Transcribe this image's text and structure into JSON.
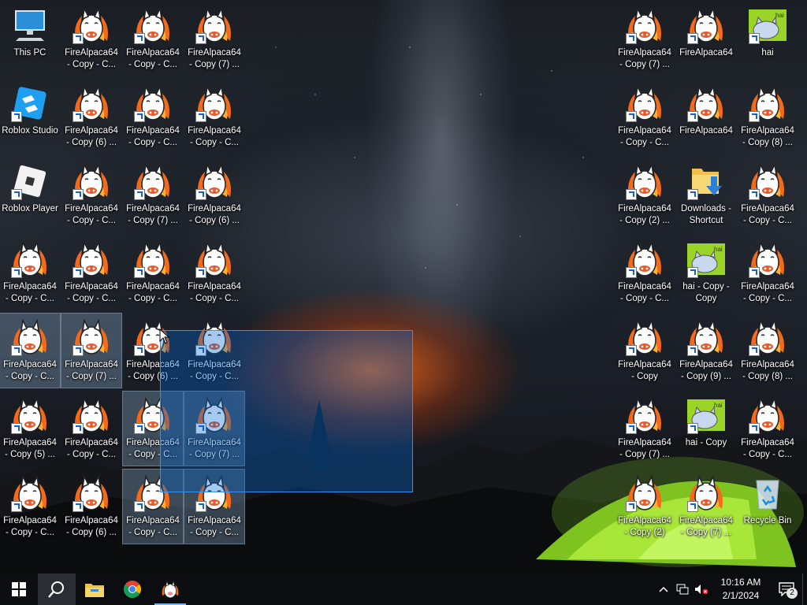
{
  "desktop": {
    "icons": [
      {
        "label": "This PC",
        "type": "thispc",
        "selected": false
      },
      {
        "label": "FireAlpaca64\n- Copy - C...",
        "type": "alpaca",
        "selected": false
      },
      {
        "label": "FireAlpaca64\n- Copy - C...",
        "type": "alpaca",
        "selected": false
      },
      {
        "label": "FireAlpaca64\n- Copy (7) ...",
        "type": "alpaca",
        "selected": false
      },
      {
        "label": "Roblox Studio",
        "type": "roblox-studio",
        "selected": false
      },
      {
        "label": "FireAlpaca64\n- Copy (6) ...",
        "type": "alpaca",
        "selected": false
      },
      {
        "label": "FireAlpaca64\n- Copy - C...",
        "type": "alpaca",
        "selected": false
      },
      {
        "label": "FireAlpaca64\n- Copy - C...",
        "type": "alpaca",
        "selected": false
      },
      {
        "label": "Roblox Player",
        "type": "roblox-player",
        "selected": false
      },
      {
        "label": "FireAlpaca64\n- Copy - C...",
        "type": "alpaca",
        "selected": false
      },
      {
        "label": "FireAlpaca64\n- Copy (7) ...",
        "type": "alpaca",
        "selected": false
      },
      {
        "label": "FireAlpaca64\n- Copy (6) ...",
        "type": "alpaca",
        "selected": false
      },
      {
        "label": "FireAlpaca64\n- Copy - C...",
        "type": "alpaca",
        "selected": false
      },
      {
        "label": "FireAlpaca64\n- Copy - C...",
        "type": "alpaca",
        "selected": false
      },
      {
        "label": "FireAlpaca64\n- Copy - C...",
        "type": "alpaca",
        "selected": false
      },
      {
        "label": "FireAlpaca64\n- Copy - C...",
        "type": "alpaca",
        "selected": false
      },
      {
        "label": "FireAlpaca64\n- Copy - C...",
        "type": "alpaca",
        "selected": true
      },
      {
        "label": "FireAlpaca64\n- Copy (7) ...",
        "type": "alpaca",
        "selected": true
      },
      {
        "label": "FireAlpaca64\n- Copy (6) ...",
        "type": "alpaca",
        "selected": false
      },
      {
        "label": "FireAlpaca64\n- Copy - C...",
        "type": "alpaca",
        "selected": false
      },
      {
        "label": "FireAlpaca64\n- Copy (5) ...",
        "type": "alpaca",
        "selected": false
      },
      {
        "label": "FireAlpaca64\n- Copy - C...",
        "type": "alpaca",
        "selected": false
      },
      {
        "label": "FireAlpaca64\n- Copy - C...",
        "type": "alpaca",
        "selected": true
      },
      {
        "label": "FireAlpaca64\n- Copy (7) ...",
        "type": "alpaca",
        "selected": true
      },
      {
        "label": "FireAlpaca64\n- Copy - C...",
        "type": "alpaca",
        "selected": false
      },
      {
        "label": "FireAlpaca64\n- Copy (6) ...",
        "type": "alpaca",
        "selected": false
      },
      {
        "label": "FireAlpaca64\n- Copy - C...",
        "type": "alpaca",
        "selected": true
      },
      {
        "label": "FireAlpaca64\n- Copy - C...",
        "type": "alpaca",
        "selected": true
      },
      {
        "label": "FireAlpaca64\n- Copy (7) ...",
        "type": "alpaca",
        "selected": false
      },
      {
        "label": "FireAlpaca64",
        "type": "alpaca",
        "selected": false
      },
      {
        "label": "hai",
        "type": "hai",
        "selected": false
      },
      {
        "label": "FireAlpaca64\n- Copy - C...",
        "type": "alpaca",
        "selected": false
      },
      {
        "label": "FireAlpaca64",
        "type": "alpaca",
        "selected": false
      },
      {
        "label": "FireAlpaca64\n- Copy (8) ...",
        "type": "alpaca",
        "selected": false
      },
      {
        "label": "FireAlpaca64\n- Copy (2) ...",
        "type": "alpaca",
        "selected": false
      },
      {
        "label": "Downloads -\nShortcut",
        "type": "downloads",
        "selected": false
      },
      {
        "label": "FireAlpaca64\n- Copy - C...",
        "type": "alpaca",
        "selected": false
      },
      {
        "label": "FireAlpaca64\n- Copy - C...",
        "type": "alpaca",
        "selected": false
      },
      {
        "label": "hai - Copy -\nCopy",
        "type": "hai",
        "selected": false
      },
      {
        "label": "FireAlpaca64\n- Copy - C...",
        "type": "alpaca",
        "selected": false
      },
      {
        "label": "FireAlpaca64\n- Copy",
        "type": "alpaca",
        "selected": false
      },
      {
        "label": "FireAlpaca64\n- Copy (9) ...",
        "type": "alpaca",
        "selected": false
      },
      {
        "label": "FireAlpaca64\n- Copy (8) ...",
        "type": "alpaca",
        "selected": false
      },
      {
        "label": "FireAlpaca64\n- Copy (7) ...",
        "type": "alpaca",
        "selected": false
      },
      {
        "label": "hai - Copy",
        "type": "hai",
        "selected": false
      },
      {
        "label": "FireAlpaca64\n- Copy - C...",
        "type": "alpaca",
        "selected": false
      },
      {
        "label": "FireAlpaca64\n- Copy (2)",
        "type": "alpaca",
        "selected": false
      },
      {
        "label": "FireAlpaca64\n- Copy (7) ...",
        "type": "alpaca",
        "selected": false
      },
      {
        "label": "Recycle Bin",
        "type": "recycle",
        "selected": false
      }
    ]
  },
  "taskbar": {
    "start_icon": "windows-logo-icon",
    "search_icon": "search-icon",
    "pinned": [
      {
        "name": "file-explorer-icon"
      },
      {
        "name": "chrome-icon"
      },
      {
        "name": "firealpaca-icon"
      }
    ],
    "clock_time": "10:16 AM",
    "clock_date": "2/1/2024",
    "notification_count": "2",
    "accent_color": "#7ab4f0"
  }
}
